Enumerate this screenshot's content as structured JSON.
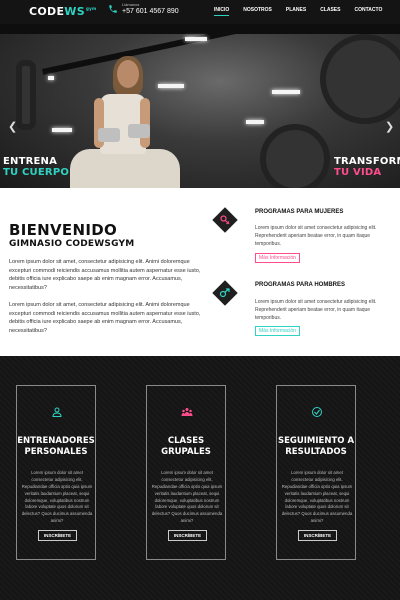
{
  "header": {
    "logo_main": "CODE",
    "logo_accent": "WS",
    "logo_sup": "gym",
    "phone_label": "Llámanos",
    "phone_number": "+57 601 4567 890",
    "nav": [
      "INICIO",
      "NOSOTROS",
      "PLANES",
      "CLASES",
      "CONTACTO"
    ],
    "active_nav": "INICIO",
    "accent_color": "#2fd3c2",
    "pink_color": "#ff4c8b"
  },
  "hero": {
    "left_white": "ENTRENA",
    "left_color": "TU CUERPO",
    "right_white": "TRANSFORMA",
    "right_color": "TU VIDA",
    "prev_icon": "chevron-left-icon",
    "next_icon": "chevron-right-icon"
  },
  "intro": {
    "title": "BIENVENIDO",
    "subtitle": "GIMNASIO CODEWSGYM",
    "paragraphs": [
      "Lorem ipsum dolor sit amet, consectetur adipisicing elit. Animi doloremque excepturi commodi reiciendis accusamus mollitia autem aspernatur esse iusto, debitis officia iure explicabo saepe ab enim magnam error. Accusamus, necessitatibus?",
      "Lorem ipsum dolor sit amet, consectetur adipisicing elit. Animi doloremque excepturi commodi reiciendis accusamus mollitia autem aspernatur esse iusto, debitis officia iure explicabo saepe ab enim magnam error. Accusamus, necessitatibus?"
    ],
    "programs": [
      {
        "title": "PROGRAMAS PARA MUJERES",
        "text": "Lorem ipsum dolor sit amet consectetur adipisicing elit. Reprehenderit aperiam beatae error, in quam itaque temporibus.",
        "button": "Más Información",
        "icon": "female-icon"
      },
      {
        "title": "PROGRAMAS PARA HOMBRES",
        "text": "Lorem ipsum dolor sit amet consectetur adipisicing elit. Reprehenderit aperiam beatae error, in quam itaque temporibus.",
        "button": "Más Información",
        "icon": "male-icon"
      }
    ]
  },
  "cards": [
    {
      "title_line1": "ENTRENADORES",
      "title_line2": "PERSONALES",
      "text": "Lorem ipsum dolor sit amet consectetur adipisicing elit. Repudiandae officia optio quia ipsum veritatis laudantium placeat, sequi doloremque, voluptatibus nostrum labore voluptate quos dolorum sit delectus? Quos ducimus assumenda animi?",
      "button": "INSCRÍBETE",
      "icon": "person-icon"
    },
    {
      "title_line1": "CLASES",
      "title_line2": "GRUPALES",
      "text": "Lorem ipsum dolor sit amet consectetur adipisicing elit. Repudiandae officia optio quia ipsum veritatis laudantium placeat, sequi doloremque, voluptatibus nostrum labore voluptate quos dolorum sit delectus? Quos ducimus assumenda animi?",
      "button": "INSCRÍBETE",
      "icon": "group-icon"
    },
    {
      "title_line1": "SEGUIMIENTO A",
      "title_line2": "RESULTADOS",
      "text": "Lorem ipsum dolor sit amet consectetur adipisicing elit. Repudiandae officia optio quia ipsum veritatis laudantium placeat, sequi doloremque, voluptatibus nostrum labore voluptate quos dolorum sit delectus? Quos ducimus assumenda animi?",
      "button": "INSCRÍBETE",
      "icon": "check-circle-icon"
    }
  ]
}
